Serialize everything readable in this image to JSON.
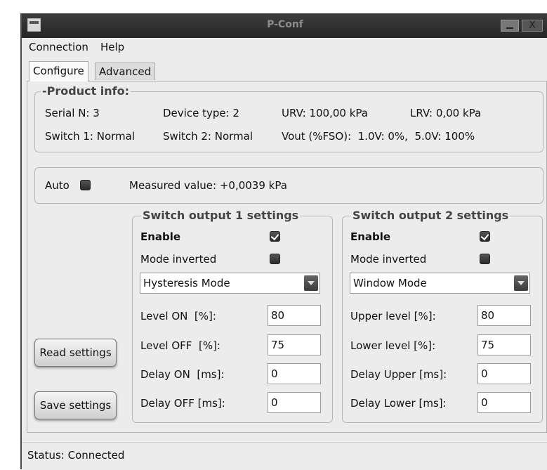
{
  "window": {
    "title": "P-Conf",
    "close_label": "X"
  },
  "menu": {
    "items": [
      "Connection",
      "Help"
    ]
  },
  "tabs": {
    "configure": "Configure",
    "advanced": "Advanced"
  },
  "product_info": {
    "title": "-Product info:",
    "serial": "Serial N: 3",
    "device_type": "Device type: 2",
    "urv": "URV: 100,00 kPa",
    "lrv": "LRV: 0,00 kPa",
    "switch1": "Switch 1: Normal",
    "switch2": "Switch 2: Normal",
    "vout": "Vout (%FSO):  1.0V: 0%,  5.0V: 100%"
  },
  "measure": {
    "auto_label": "Auto",
    "auto_checked": false,
    "measured": "Measured value: +0,0039 kPa"
  },
  "switch1": {
    "title": "Switch output 1 settings",
    "enable_label": "Enable",
    "enable_checked": true,
    "inverted_label": "Mode inverted",
    "inverted_checked": false,
    "mode": "Hysteresis Mode",
    "fields": [
      {
        "label": "Level ON  [%]:",
        "value": "80"
      },
      {
        "label": "Level OFF  [%]:",
        "value": "75"
      },
      {
        "label": "Delay ON  [ms]:",
        "value": "0"
      },
      {
        "label": "Delay OFF [ms]:",
        "value": "0"
      }
    ]
  },
  "switch2": {
    "title": "Switch output 2 settings",
    "enable_label": "Enable",
    "enable_checked": true,
    "inverted_label": "Mode inverted",
    "inverted_checked": false,
    "mode": "Window Mode",
    "fields": [
      {
        "label": "Upper level [%]:",
        "value": "80"
      },
      {
        "label": "Lower level [%]:",
        "value": "75"
      },
      {
        "label": "Delay Upper [ms]:",
        "value": "0"
      },
      {
        "label": "Delay Lower [ms]:",
        "value": "0"
      }
    ]
  },
  "buttons": {
    "read": "Read settings",
    "save": "Save settings"
  },
  "status": {
    "text": "Status: Connected"
  }
}
